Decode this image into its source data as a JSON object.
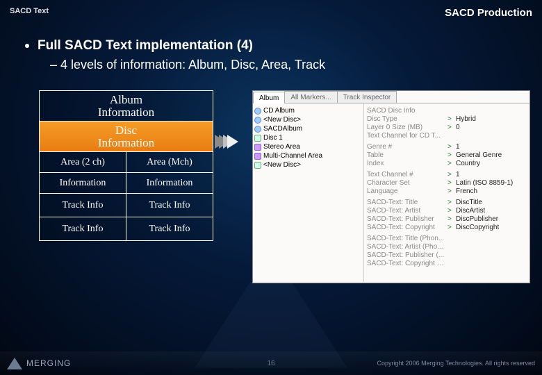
{
  "header": {
    "left": "SACD Text",
    "right": "SACD Production"
  },
  "bullets": {
    "main": "Full SACD Text implementation (4)",
    "sub": "4 levels of information: Album, Disc, Area, Track"
  },
  "hierarchy": {
    "album": "Album\nInformation",
    "disc": "Disc\nInformation",
    "area2ch": "Area (2 ch)",
    "areaMch": "Area (Mch)",
    "info": "Information",
    "track": "Track Info"
  },
  "panel": {
    "tabs": [
      "Album",
      "All Markers...",
      "Track Inspector"
    ],
    "active_tab": 0,
    "tree": [
      {
        "icon": "cd",
        "indent": 0,
        "label": "CD Album"
      },
      {
        "icon": "cd",
        "indent": 1,
        "label": "<New Disc>"
      },
      {
        "icon": "cd",
        "indent": 0,
        "label": "SACDAlbum"
      },
      {
        "icon": "disc",
        "indent": 1,
        "label": "Disc 1"
      },
      {
        "icon": "area",
        "indent": 2,
        "label": "Stereo Area"
      },
      {
        "icon": "area",
        "indent": 2,
        "label": "Multi-Channel Area"
      },
      {
        "icon": "disc",
        "indent": 1,
        "label": "<New Disc>"
      }
    ],
    "props": [
      [
        {
          "k": "SACD Disc Info",
          "v": ""
        },
        {
          "k": "Disc Type",
          "v": "Hybrid"
        },
        {
          "k": "Layer 0 Size (MB)",
          "v": "0"
        },
        {
          "k": "Text Channel for CD T...",
          "v": ""
        }
      ],
      [
        {
          "k": "Genre #",
          "v": "1"
        },
        {
          "k": "Table",
          "v": "General Genre"
        },
        {
          "k": "Index",
          "v": "Country"
        }
      ],
      [
        {
          "k": "Text Channel #",
          "v": "1"
        },
        {
          "k": "Character Set",
          "v": "Latin (ISO 8859-1)"
        },
        {
          "k": "Language",
          "v": "French"
        }
      ],
      [
        {
          "k": "SACD-Text: Title",
          "v": "DiscTitle"
        },
        {
          "k": "SACD-Text: Artist",
          "v": "DiscArtist"
        },
        {
          "k": "SACD-Text: Publisher",
          "v": "DiscPublisher"
        },
        {
          "k": "SACD-Text: Copyright",
          "v": "DiscCopyright"
        }
      ],
      [
        {
          "k": "SACD-Text: Title (Phon...",
          "v": ""
        },
        {
          "k": "SACD-Text: Artist (Pho...",
          "v": ""
        },
        {
          "k": "SACD-Text: Publisher (...",
          "v": ""
        },
        {
          "k": "SACD-Text: Copyright (...",
          "v": ""
        }
      ]
    ]
  },
  "footer": {
    "brand": "MERGING",
    "page": "16",
    "copyright": "Copyright 2006 Merging Technologies. All rights reserved"
  }
}
